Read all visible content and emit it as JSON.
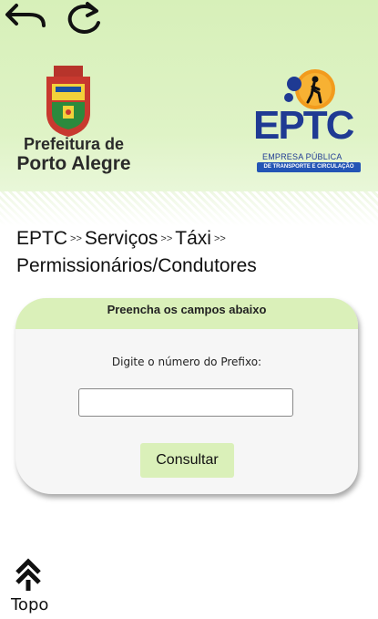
{
  "header": {
    "back_icon": "undo-arrow-icon",
    "reload_icon": "reload-icon",
    "prefeitura": {
      "line1": "Prefeitura de",
      "line2": "Porto Alegre"
    },
    "eptc": {
      "big": "EPTC",
      "sub1": "EMPRESA PÚBLICA",
      "sub2": "DE TRANSPORTE E CIRCULAÇÃO"
    },
    "colors": {
      "header_bg": "#d7f0b9",
      "eptc_blue": "#1f3a93",
      "eptc_orange": "#f29b1d"
    }
  },
  "breadcrumb": {
    "items": [
      "EPTC",
      "Serviços",
      "Táxi",
      "Permissionários/Condutores"
    ],
    "separator": ">>"
  },
  "form": {
    "header": "Preencha os campos abaixo",
    "label": "Digite o número do Prefixo:",
    "input_value": "",
    "input_placeholder": "",
    "button": "Consultar",
    "accent": "#daf0b9"
  },
  "footer": {
    "top_label": "Topo",
    "top_icon": "double-chevron-up-icon"
  }
}
